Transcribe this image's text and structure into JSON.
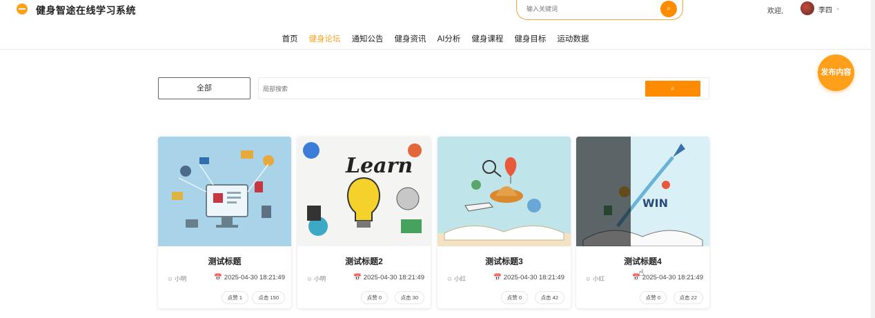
{
  "header": {
    "app_title": "健身智途在线学习系统",
    "search_placeholder": "输入关键词",
    "welcome": "欢迎,",
    "username": "李四",
    "caret": "⌄",
    "search_glyph": "⌕"
  },
  "nav": {
    "items": [
      {
        "label": "首页",
        "active": false
      },
      {
        "label": "健身论坛",
        "active": true
      },
      {
        "label": "通知公告",
        "active": false
      },
      {
        "label": "健身资讯",
        "active": false
      },
      {
        "label": "AI分析",
        "active": false
      },
      {
        "label": "健身课程",
        "active": false
      },
      {
        "label": "健身目标",
        "active": false
      },
      {
        "label": "运动数据",
        "active": false
      }
    ]
  },
  "publish_label": "发布内容",
  "filter": {
    "all_label": "全部",
    "search_placeholder": "局部搜索",
    "search_glyph": "⌕"
  },
  "cards": [
    {
      "title": "测试标题",
      "author": "小明",
      "date": "2025-04-30 18:21:49",
      "likes_label": "点赞 1",
      "clicks_label": "点击 150",
      "image": "ecommerce-illustration"
    },
    {
      "title": "测试标题2",
      "author": "小明",
      "date": "2025-04-30 18:21:49",
      "likes_label": "点赞 0",
      "clicks_label": "点击 30",
      "image": "learn-lightbulb-illustration"
    },
    {
      "title": "测试标题3",
      "author": "小红",
      "date": "2025-04-30 18:21:49",
      "likes_label": "点赞 0",
      "clicks_label": "点击 42",
      "image": "open-book-travel-illustration"
    },
    {
      "title": "测试标题4",
      "author": "小红",
      "date": "2025-04-30 18:21:49",
      "likes_label": "点赞 0",
      "clicks_label": "点击 22",
      "image": "open-book-win-rocket-illustration"
    }
  ],
  "colors": {
    "accent": "#ff9f1a",
    "accent_dark": "#ff8c00"
  }
}
